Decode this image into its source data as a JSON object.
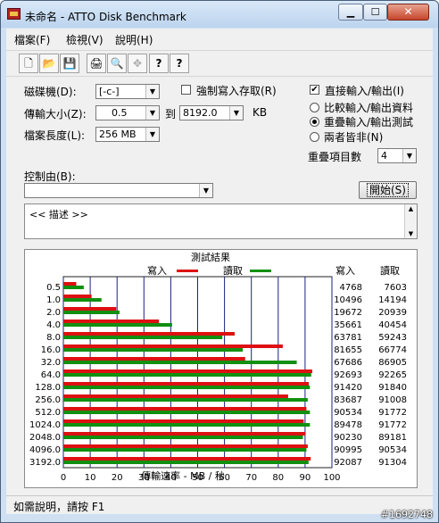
{
  "window": {
    "title": "未命名 - ATTO Disk Benchmark",
    "min_glyph": "▁",
    "max_glyph": "☐",
    "close_glyph": "✕"
  },
  "menu": [
    "檔案(F)",
    "檢視(V)",
    "說明(H)"
  ],
  "toolbar": {
    "icons": [
      "new-icon",
      "open-icon",
      "save-icon",
      "print-icon",
      "print-preview-icon",
      "move-icon",
      "help-icon",
      "context-help-icon"
    ],
    "glyphs": [
      "🗋",
      "📂",
      "💾",
      "🖨",
      "🔍",
      "✥",
      "?",
      "?"
    ]
  },
  "settings": {
    "drive_label": "磁碟機(D):",
    "drive_value": "[-c-]",
    "force_write_access_label": "強制寫入存取(R)",
    "force_write_access_checked": false,
    "direct_io_label": "直接輸入/輸出(I)",
    "direct_io_checked": true,
    "transfer_size_label": "傳輸大小(Z):",
    "transfer_min": "0.5",
    "transfer_to": "到",
    "transfer_max": "8192.0",
    "transfer_unit": "KB",
    "file_length_label": "檔案長度(L):",
    "file_length_value": "256 MB",
    "io_compare_label": "比較輸入/輸出資料",
    "overlapped_io_label": "重疊輸入/輸出測試",
    "neither_label": "兩者皆非(N)",
    "selected_mode": "overlapped",
    "queue_depth_label": "重疊項目數",
    "queue_depth_value": "4",
    "controlled_by_label": "控制由(B):",
    "controlled_by_value": "",
    "start_button": "開始(S)",
    "description": "<<     描述     >>"
  },
  "results": {
    "group_label": "測試結果",
    "write_header": "寫入",
    "read_header": "讀取",
    "write_color": "#dd1111",
    "read_color": "#119011"
  },
  "chart_data": {
    "type": "bar",
    "orientation": "horizontal",
    "categories": [
      "0.5",
      "1.0",
      "2.0",
      "4.0",
      "8.0",
      "16.0",
      "32.0",
      "64.0",
      "128.0",
      "256.0",
      "512.0",
      "1024.0",
      "2048.0",
      "4096.0",
      "3192.0"
    ],
    "series": [
      {
        "name": "寫入",
        "values": [
          4.8,
          10.5,
          19.7,
          35.6,
          63.8,
          81.7,
          67.7,
          92.7,
          91.4,
          83.7,
          90.5,
          89.5,
          90.2,
          91.0,
          92.1
        ]
      },
      {
        "name": "讀取",
        "values": [
          7.6,
          14.2,
          20.9,
          40.5,
          59.2,
          66.8,
          86.9,
          92.3,
          91.8,
          91.0,
          91.8,
          91.8,
          89.2,
          90.5,
          91.3
        ]
      }
    ],
    "table": {
      "write": [
        "4768",
        "10496",
        "19672",
        "35661",
        "63781",
        "81655",
        "67686",
        "92693",
        "91420",
        "83687",
        "90534",
        "89478",
        "90230",
        "90995",
        "92087"
      ],
      "read": [
        "7603",
        "14194",
        "20939",
        "40454",
        "59243",
        "66774",
        "86905",
        "92265",
        "91840",
        "91008",
        "91772",
        "91772",
        "89181",
        "90534",
        "91304"
      ]
    },
    "xlabel": "傳輸速率 - MB / 秒",
    "xticks": [
      "0",
      "10",
      "20",
      "30",
      "40",
      "50",
      "60",
      "70",
      "80",
      "90",
      "100"
    ],
    "xlim": [
      0,
      100
    ],
    "grid": true
  },
  "status": {
    "text": "如需說明，請按 F1"
  },
  "watermark": "#1692748"
}
